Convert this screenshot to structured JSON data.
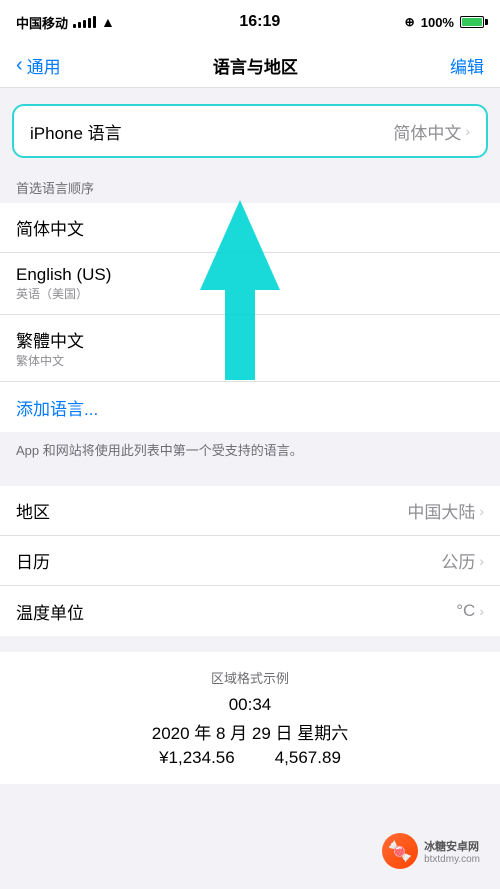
{
  "status_bar": {
    "carrier": "中国移动",
    "time": "16:19",
    "battery_percent": "100%"
  },
  "nav": {
    "back_label": "通用",
    "title": "语言与地区",
    "edit_label": "编辑"
  },
  "iphone_language": {
    "label": "iPhone 语言",
    "value": "简体中文",
    "chevron": ">"
  },
  "preferred_languages": {
    "section_header": "首选语言顺序",
    "items": [
      {
        "main": "简体中文",
        "sub": ""
      },
      {
        "main": "English (US)",
        "sub": "英语（美国）"
      },
      {
        "main": "繁體中文",
        "sub": "繁体中文"
      }
    ],
    "add_language": "添加语言..."
  },
  "info_text": "App 和网站将使用此列表中第一个受支持的语言。",
  "region_rows": [
    {
      "label": "地区",
      "value": "中国大陆",
      "chevron": ">"
    },
    {
      "label": "日历",
      "value": "公历",
      "chevron": ">"
    },
    {
      "label": "温度单位",
      "value": "°C",
      "chevron": ">"
    }
  ],
  "format_example": {
    "title": "区域格式示例",
    "time": "00:34",
    "date": "2020 年 8 月 29 日 星期六",
    "num1": "¥1,234.56",
    "num2": "4,567.89"
  },
  "watermark": {
    "site": "冰糖安卓网",
    "url": "btxtdmy.com"
  }
}
